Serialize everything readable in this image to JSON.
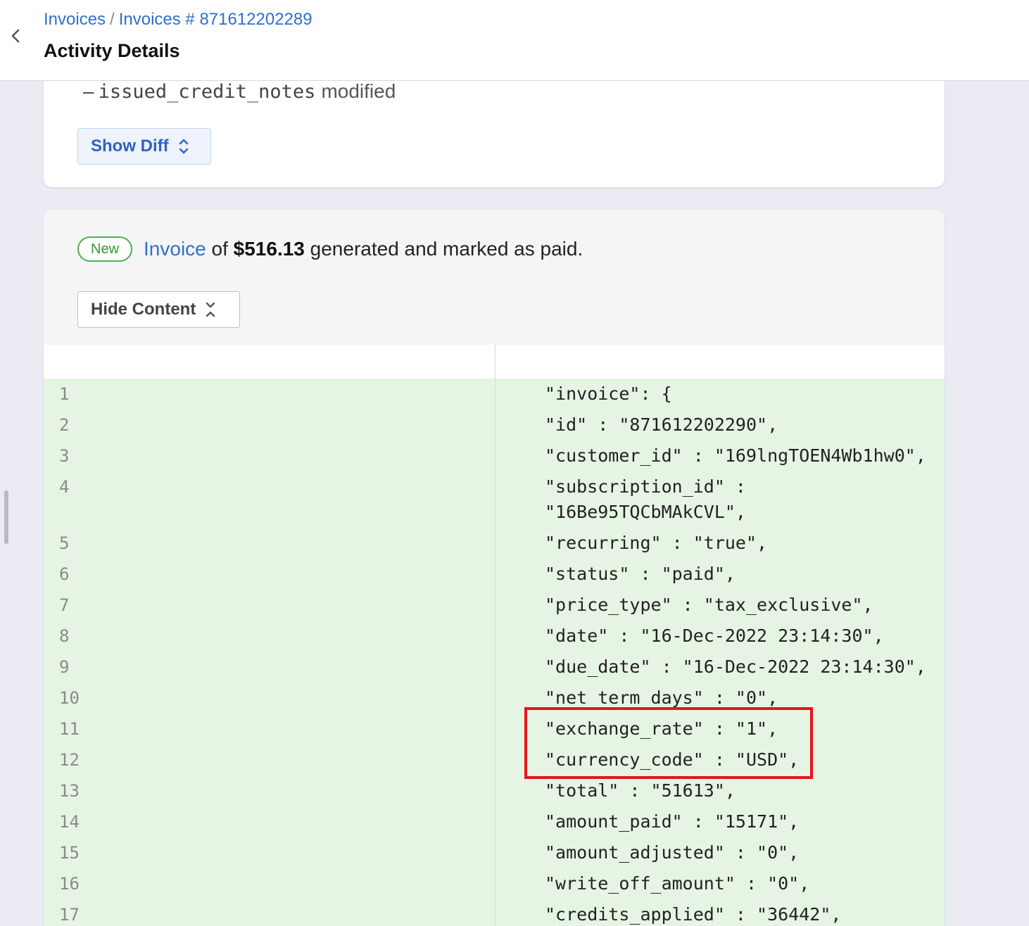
{
  "header": {
    "breadcrumb": [
      {
        "label": "Invoices"
      },
      {
        "label": "Invoices # 871612202289"
      }
    ],
    "separator": "/",
    "title": "Activity Details"
  },
  "card_modified": {
    "dash": "–",
    "field": "issued_credit_notes",
    "status": "modified",
    "show_diff_label": "Show Diff"
  },
  "card_new": {
    "badge": "New",
    "link_text": "Invoice",
    "text_of": "of",
    "amount": "$516.13",
    "text_rest": "generated and marked as paid.",
    "hide_content_label": "Hide Content"
  },
  "diff_lines": [
    {
      "n": "1",
      "code": "\"invoice\": {"
    },
    {
      "n": "2",
      "code": "\"id\" : \"871612202290\","
    },
    {
      "n": "3",
      "code": "\"customer_id\" : \"169lngTOEN4Wb1hw0\","
    },
    {
      "n": "4",
      "code": "\"subscription_id\" :",
      "code2": "\"16Be95TQCbMAkCVL\","
    },
    {
      "n": "5",
      "code": "\"recurring\" : \"true\","
    },
    {
      "n": "6",
      "code": "\"status\" : \"paid\","
    },
    {
      "n": "7",
      "code": "\"price_type\" : \"tax_exclusive\","
    },
    {
      "n": "8",
      "code": "\"date\" : \"16-Dec-2022 23:14:30\","
    },
    {
      "n": "9",
      "code": "\"due_date\" : \"16-Dec-2022 23:14:30\","
    },
    {
      "n": "10",
      "code": "\"net_term_days\" : \"0\","
    },
    {
      "n": "11",
      "code": "\"exchange_rate\" : \"1\","
    },
    {
      "n": "12",
      "code": "\"currency_code\" : \"USD\","
    },
    {
      "n": "13",
      "code": "\"total\" : \"51613\","
    },
    {
      "n": "14",
      "code": "\"amount_paid\" : \"15171\","
    },
    {
      "n": "15",
      "code": "\"amount_adjusted\" : \"0\","
    },
    {
      "n": "16",
      "code": "\"write_off_amount\" : \"0\","
    },
    {
      "n": "17",
      "code": "\"credits_applied\" : \"36442\","
    }
  ],
  "colors": {
    "link": "#2f6fd0",
    "added_row_bg": "#e6f5e3",
    "badge_green": "#4db04f",
    "annotation_red": "#e8131b"
  },
  "icons": {
    "back": "chevron-left-icon",
    "show_diff": "chevron-up-down-icon",
    "hide_content": "chevron-collapse-icon"
  }
}
